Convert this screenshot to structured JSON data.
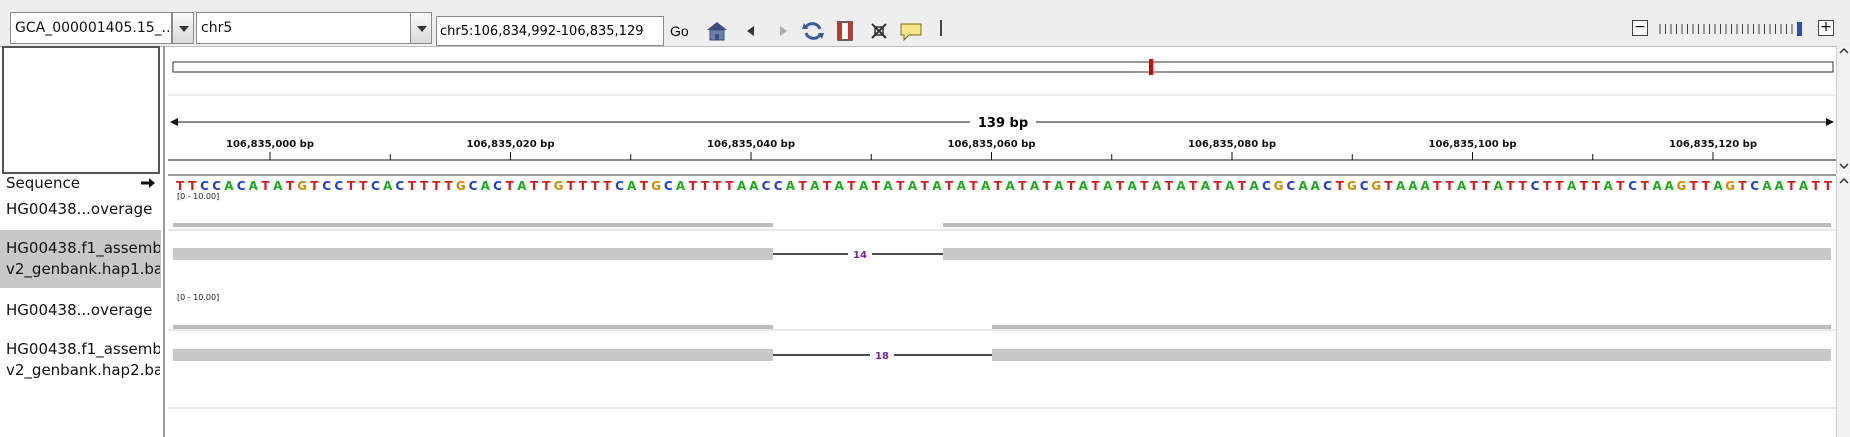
{
  "toolbar": {
    "genome_value": "GCA_000001405.15_...",
    "chromosome_value": "chr5",
    "locus_value": "chr5:106,834,992-106,835,129",
    "go_label": "Go"
  },
  "ruler": {
    "span_label": "139 bp",
    "ticks": [
      "106,835,000 bp",
      "106,835,020 bp",
      "106,835,040 bp",
      "106,835,060 bp",
      "106,835,080 bp",
      "106,835,100 bp",
      "106,835,120 bp"
    ]
  },
  "tracks": {
    "sequence_label": "Sequence",
    "sequence": "TTCCACATATGTCCTTCACTTTTGCACTATTGTTTTCATGCATTTTAACCATATATATATATATATATATATATATATATATATATATACGCAACTGCGTAAATTATTATTCTTATTATCTAAGTTAGTCAATATT",
    "coverage1_label": "HG00438...overage",
    "coverage1_range": "[0 - 10.00]",
    "alignment1_label_line1": "HG00438.f1_assemb",
    "alignment1_label_line2": "v2_genbank.hap1.ba",
    "deletion1": "14",
    "coverage2_label": "HG00438...overage",
    "coverage2_range": "[0 - 10.00]",
    "alignment2_label_line1": "HG00438.f1_assemb",
    "alignment2_label_line2": "v2_genbank.hap2.ba",
    "deletion2": "18"
  },
  "colors": {
    "base_A": "#1faa1f",
    "base_C": "#1f3fd1",
    "base_G": "#d18a00",
    "base_T": "#d11f1f",
    "read_fill": "#c8c8c8",
    "deletion_label": "#7b1fa2",
    "cytoband_marker": "#e00000",
    "selected_track_bg": "#c8c8c8"
  },
  "icons": [
    "home-icon",
    "back-icon",
    "forward-icon",
    "refresh-icon",
    "roi-icon",
    "fit-window-icon",
    "popup-info-icon",
    "zoom-out-icon",
    "zoom-in-icon",
    "arrow-right-icon"
  ]
}
